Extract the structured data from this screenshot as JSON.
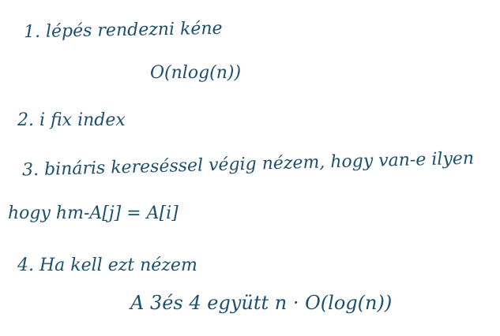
{
  "page": {
    "ink_color": "#1c4f6d",
    "background": "#ffffff"
  },
  "lines": {
    "step1": "1. lépés rendezni kéne",
    "step1_complexity": "O(nlog(n))",
    "step2": "2. i fix index",
    "step3": "3. bináris kereséssel végig nézem, hogy van-e ilyen",
    "step3_cont": "hogy hm-A[j] = A[i]",
    "step4": "4. Ha kell ezt nézem",
    "step4_complexity": "A 3és 4 együtt n · O(log(n))"
  }
}
